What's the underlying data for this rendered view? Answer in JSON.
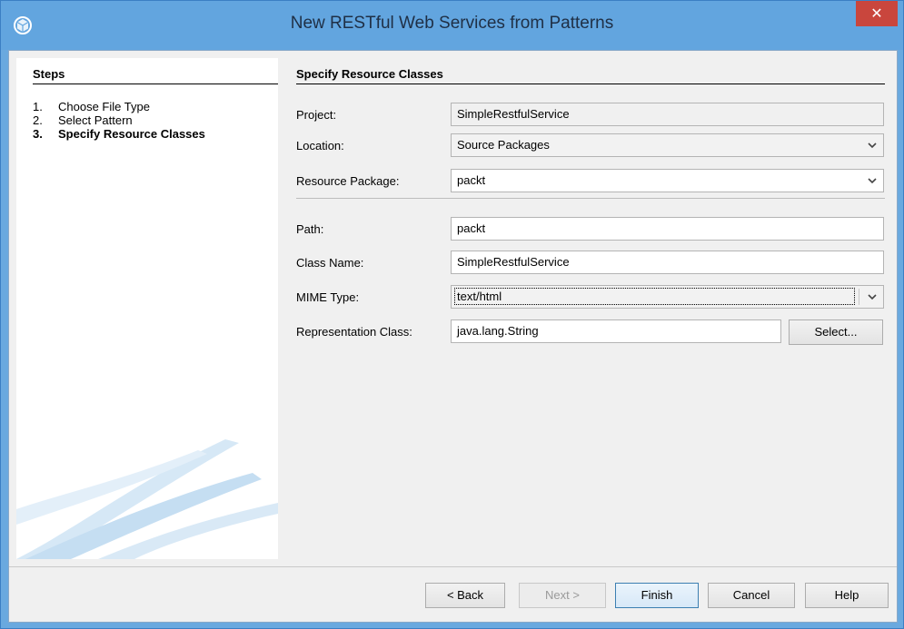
{
  "window": {
    "title": "New RESTful Web Services from Patterns",
    "close_glyph": "✕",
    "icon": "netbeans-cube-icon"
  },
  "steps": {
    "title": "Steps",
    "items": [
      {
        "num": "1.",
        "label": "Choose File Type"
      },
      {
        "num": "2.",
        "label": "Select Pattern"
      },
      {
        "num": "3.",
        "label": "Specify Resource Classes"
      }
    ],
    "current_index": 2
  },
  "form": {
    "section_title": "Specify Resource Classes",
    "project": {
      "label": "Project:",
      "value": "SimpleRestfulService"
    },
    "location": {
      "label": "Location:",
      "value": "Source Packages"
    },
    "resource_package": {
      "label": "Resource Package:",
      "value": "packt"
    },
    "path": {
      "label": "Path:",
      "value": "packt"
    },
    "class_name": {
      "label": "Class Name:",
      "value": "SimpleRestfulService"
    },
    "mime_type": {
      "label": "MIME Type:",
      "value": "text/html"
    },
    "representation_class": {
      "label": "Representation Class:",
      "value": "java.lang.String"
    },
    "select_button": "Select..."
  },
  "buttons": {
    "back": "< Back",
    "next": "Next >",
    "finish": "Finish",
    "cancel": "Cancel",
    "help": "Help"
  },
  "colors": {
    "titlebar": "#62a5df",
    "close": "#c9463d",
    "swoosh": "#c5def2"
  }
}
